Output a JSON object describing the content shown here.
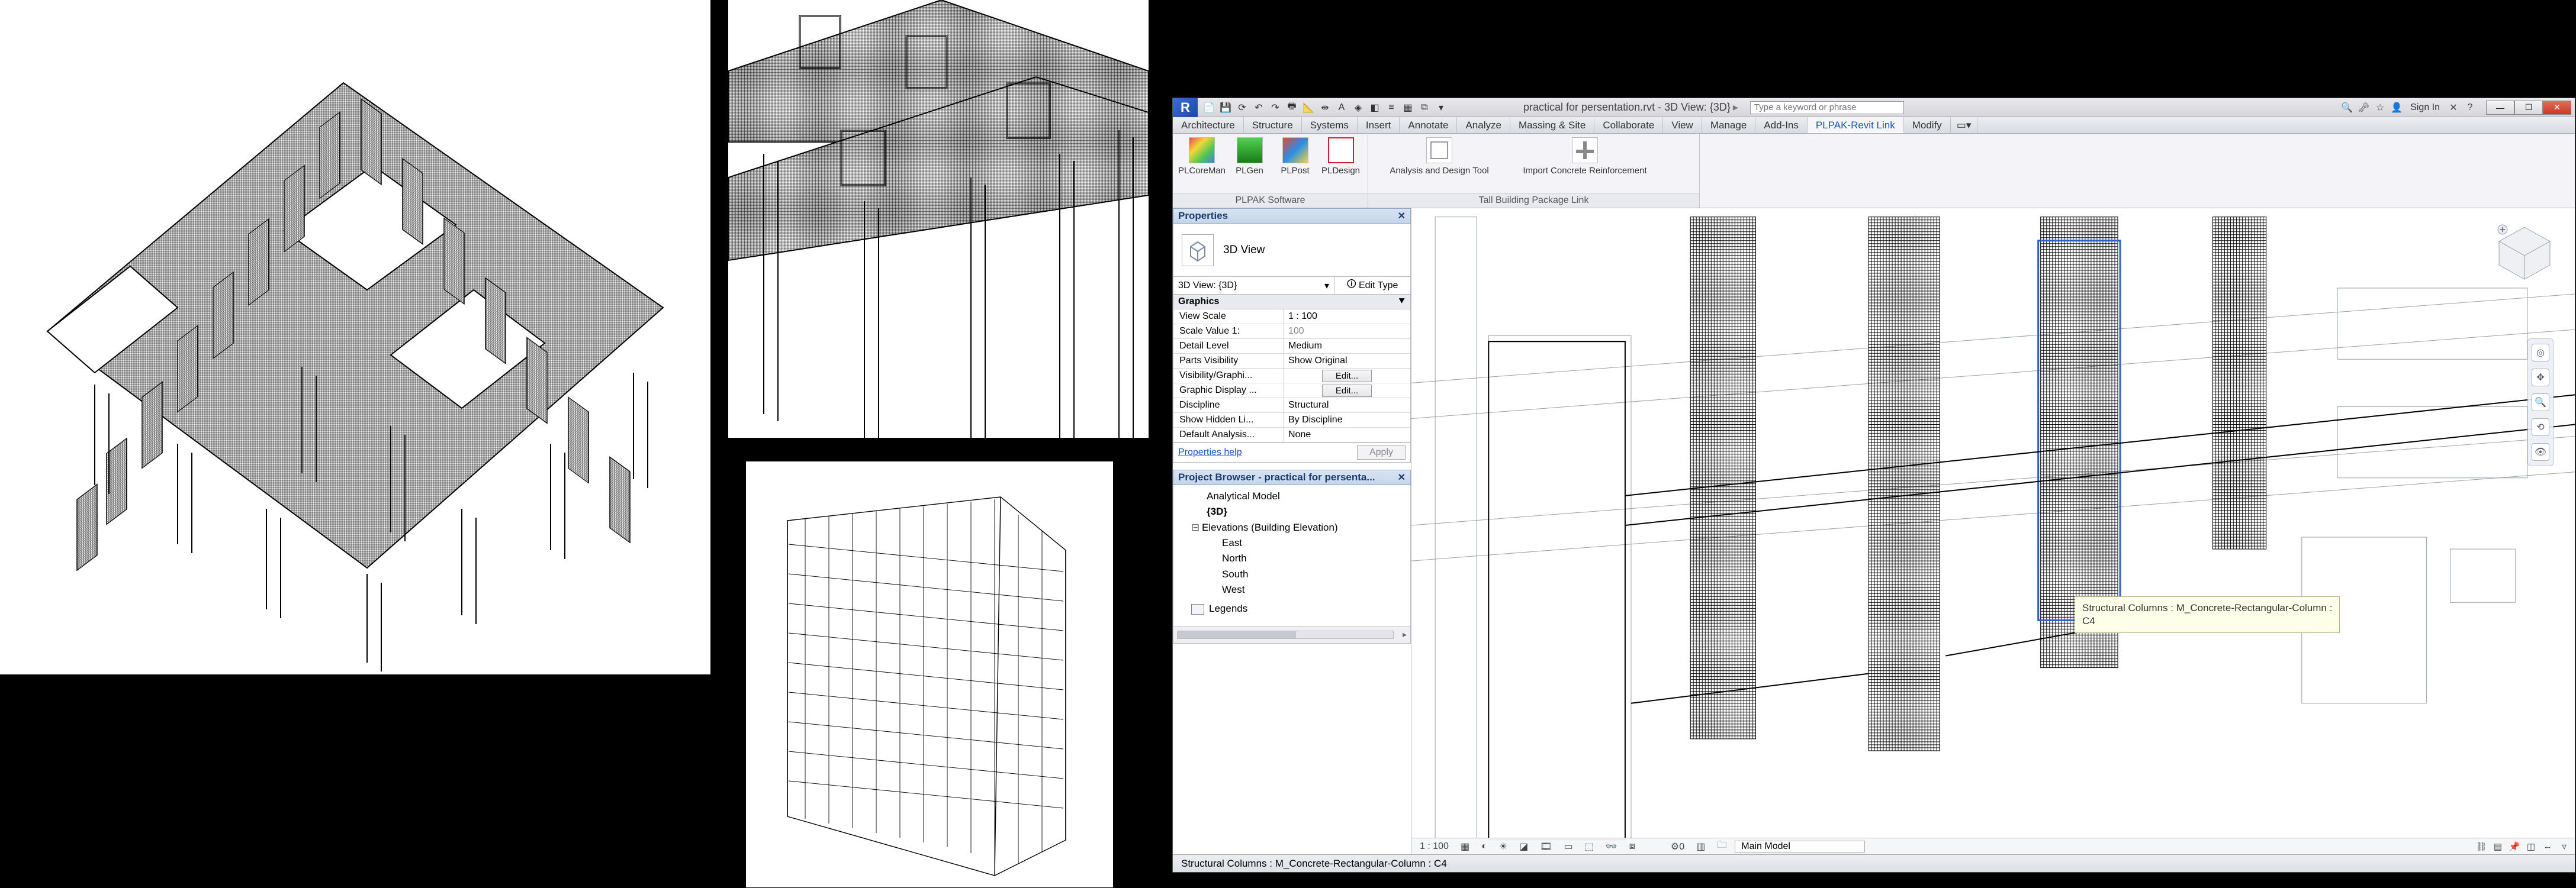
{
  "titlebar": {
    "document": "practical for persentation.rvt - 3D View: {3D}",
    "search_placeholder": "Type a keyword or phrase",
    "signin": "Sign In"
  },
  "ribbon_tabs": [
    "Architecture",
    "Structure",
    "Systems",
    "Insert",
    "Annotate",
    "Analyze",
    "Massing & Site",
    "Collaborate",
    "View",
    "Manage",
    "Add-Ins",
    "PLPAK-Revit Link",
    "Modify"
  ],
  "active_ribbon_tab": "PLPAK-Revit Link",
  "ribbon": {
    "group1": {
      "label": "PLPAK Software",
      "btns": [
        "PLCoreMan",
        "PLGen",
        "PLPost",
        "PLDesign"
      ]
    },
    "group2": {
      "label": "Tall Building Package Link",
      "btns": [
        "Analysis and Design Tool",
        "Import Concrete Reinforcement"
      ]
    }
  },
  "properties": {
    "title": "Properties",
    "type_name": "3D View",
    "selector": "3D View: {3D}",
    "edit_type": "Edit Type",
    "group": "Graphics",
    "rows": [
      {
        "k": "View Scale",
        "v": "1 : 100"
      },
      {
        "k": "Scale Value  1:",
        "v": "100"
      },
      {
        "k": "Detail Level",
        "v": "Medium"
      },
      {
        "k": "Parts Visibility",
        "v": "Show Original"
      },
      {
        "k": "Visibility/Graphi...",
        "btn": "Edit..."
      },
      {
        "k": "Graphic Display ...",
        "btn": "Edit..."
      },
      {
        "k": "Discipline",
        "v": "Structural"
      },
      {
        "k": "Show Hidden Li...",
        "v": "By Discipline"
      },
      {
        "k": "Default Analysis...",
        "v": "None"
      }
    ],
    "help": "Properties help",
    "apply": "Apply"
  },
  "browser": {
    "title": "Project Browser - practical for persenta...",
    "nodes": {
      "analytical": "Analytical Model",
      "threeD": "{3D}",
      "elev_header": "Elevations (Building Elevation)",
      "elevs": [
        "East",
        "North",
        "South",
        "West"
      ],
      "legends": "Legends"
    }
  },
  "tooltip": {
    "line1": "Structural Columns : M_Concrete-Rectangular-Column :",
    "line2": "C4"
  },
  "statusbar": {
    "selection": "Structural Columns : M_Concrete-Rectangular-Column : C4",
    "scale": "1 : 100",
    "main_model": "Main Model"
  }
}
